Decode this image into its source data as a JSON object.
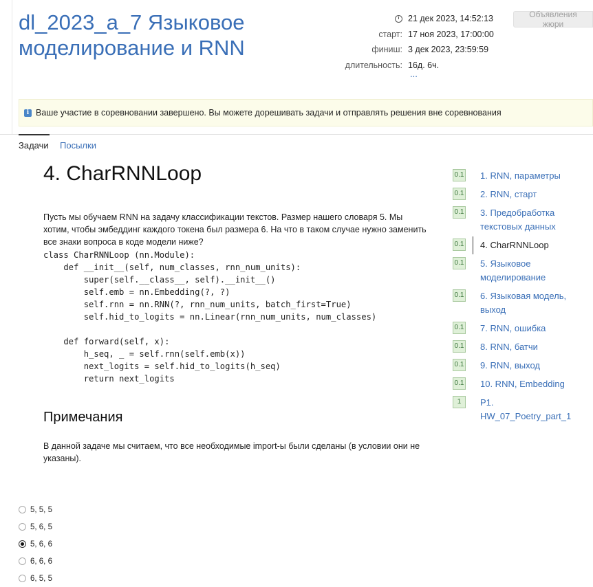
{
  "contest": {
    "title": "dl_2023_a_7 Языковое моделирование и RNN",
    "now": "21 дек 2023, 14:52:13",
    "start_label": "старт:",
    "start": "17 ноя 2023, 17:00:00",
    "finish_label": "финиш:",
    "finish": "3 дек 2023, 23:59:59",
    "duration_label": "длительность:",
    "duration": "16д. 6ч.",
    "more": "...",
    "jury_button": "Объявления жюри"
  },
  "alert": {
    "text": "Ваше участие в соревновании завершено. Вы можете дорешивать задачи и отправлять решения вне соревнования"
  },
  "tabs": [
    {
      "label": "Задачи",
      "active": true
    },
    {
      "label": "Посылки",
      "active": false
    }
  ],
  "problem": {
    "title": "4. CharRNNLoop",
    "statement": "Пусть мы обучаем RNN на задачу классификации текстов. Размер нашего словаря 5. Мы хотим, чтобы эмбеддинг каждого токена был размера 6. На что в таком случае нужно заменить все знаки вопроса в коде модели ниже?",
    "code": "class CharRNNLoop (nn.Module):\n    def __init__(self, num_classes, rnn_num_units):\n        super(self.__class__, self).__init__()\n        self.emb = nn.Embedding(?, ?)\n        self.rnn = nn.RNN(?, rnn_num_units, batch_first=True)\n        self.hid_to_logits = nn.Linear(rnn_num_units, num_classes)\n\n    def forward(self, x):\n        h_seq, _ = self.rnn(self.emb(x))\n        next_logits = self.hid_to_logits(h_seq)\n        return next_logits",
    "notes_title": "Примечания",
    "notes": "В данной задаче мы считаем, что все необходимые import-ы были сделаны (в условии они не указаны).",
    "options": [
      {
        "label": "5, 5, 5",
        "checked": false
      },
      {
        "label": "5, 6, 5",
        "checked": false
      },
      {
        "label": "5, 6, 6",
        "checked": true
      },
      {
        "label": "6, 6, 6",
        "checked": false
      },
      {
        "label": "6, 5, 5",
        "checked": false
      }
    ]
  },
  "problem_list": [
    {
      "score": "0.1",
      "name": "1. RNN, параметры"
    },
    {
      "score": "0.1",
      "name": "2. RNN, старт"
    },
    {
      "score": "0.1",
      "name": "3. Предобработка текстовых данных"
    },
    {
      "score": "0.1",
      "name": "4. CharRNNLoop",
      "current": true
    },
    {
      "score": "0.1",
      "name": "5. Языковое моделирование"
    },
    {
      "score": "0.1",
      "name": "6. Языковая модель, выход"
    },
    {
      "score": "0.1",
      "name": "7. RNN, ошибка"
    },
    {
      "score": "0.1",
      "name": "8. RNN, батчи"
    },
    {
      "score": "0.1",
      "name": "9. RNN, выход"
    },
    {
      "score": "0.1",
      "name": "10. RNN, Embedding"
    },
    {
      "score": "1",
      "name": "P1. HW_07_Poetry_part_1"
    }
  ]
}
